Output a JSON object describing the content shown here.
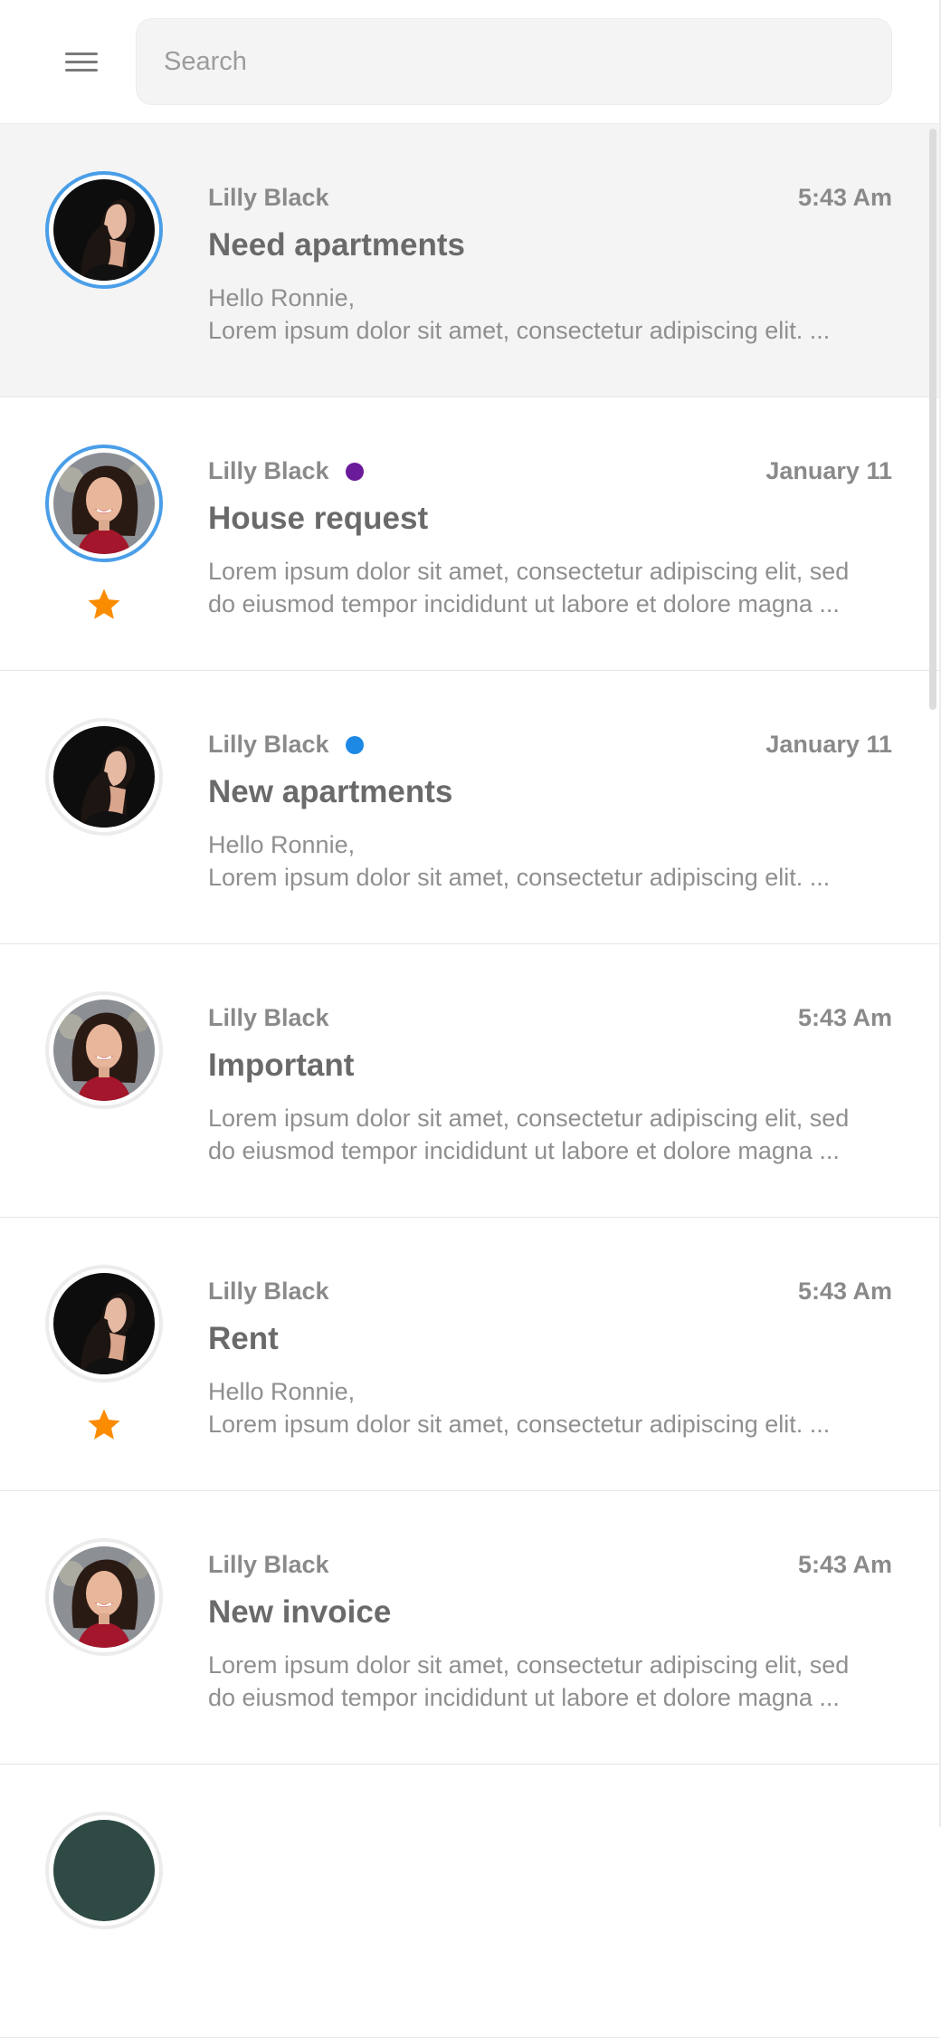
{
  "header": {
    "menu_icon": "hamburger-menu-icon",
    "search_placeholder": "Search"
  },
  "colors": {
    "selected_row_bg": "#f4f4f4",
    "avatar_ring_blue": "#4a9ee8",
    "star": "#fb8c00",
    "dot_purple": "#6a1b9a",
    "dot_blue": "#1e88e5"
  },
  "messages": [
    {
      "sender": "Lilly Black",
      "time": "5:43 Am",
      "subject": "Need apartments",
      "preview_1": "Hello Ronnie,",
      "preview_2": "Lorem ipsum dolor sit amet, consectetur adipiscing elit. ...",
      "avatar": "woman-profile-dark",
      "selected": true,
      "starred": false
    },
    {
      "sender": "Lilly Black",
      "time": "January 11",
      "subject": "House request",
      "preview_1": "Lorem ipsum dolor sit amet, consectetur adipiscing elit, sed",
      "preview_2": "do eiusmod tempor incididunt ut labore et dolore magna ...",
      "avatar": "woman-smiling-red",
      "selected": false,
      "starred": true,
      "dot": "purple"
    },
    {
      "sender": "Lilly Black",
      "time": "January 11",
      "subject": "New apartments",
      "preview_1": "Hello Ronnie,",
      "preview_2": "Lorem ipsum dolor sit amet, consectetur adipiscing elit. ...",
      "avatar": "woman-profile-dark",
      "selected": false,
      "starred": false,
      "dot": "blue"
    },
    {
      "sender": "Lilly Black",
      "time": "5:43 Am",
      "subject": "Important",
      "preview_1": "Lorem ipsum dolor sit amet, consectetur adipiscing elit, sed",
      "preview_2": "do eiusmod tempor incididunt ut labore et dolore magna ...",
      "avatar": "woman-smiling-red",
      "selected": false,
      "starred": false
    },
    {
      "sender": "Lilly Black",
      "time": "5:43 Am",
      "subject": "Rent",
      "preview_1": "Hello Ronnie,",
      "preview_2": "Lorem ipsum dolor sit amet, consectetur adipiscing elit. ...",
      "avatar": "woman-profile-dark",
      "selected": false,
      "starred": true
    },
    {
      "sender": "Lilly Black",
      "time": "5:43 Am",
      "subject": "New invoice",
      "preview_1": "Lorem ipsum dolor sit amet, consectetur adipiscing elit, sed",
      "preview_2": "do eiusmod tempor incididunt ut labore et dolore magna ...",
      "avatar": "woman-smiling-red",
      "selected": false,
      "starred": false
    }
  ]
}
